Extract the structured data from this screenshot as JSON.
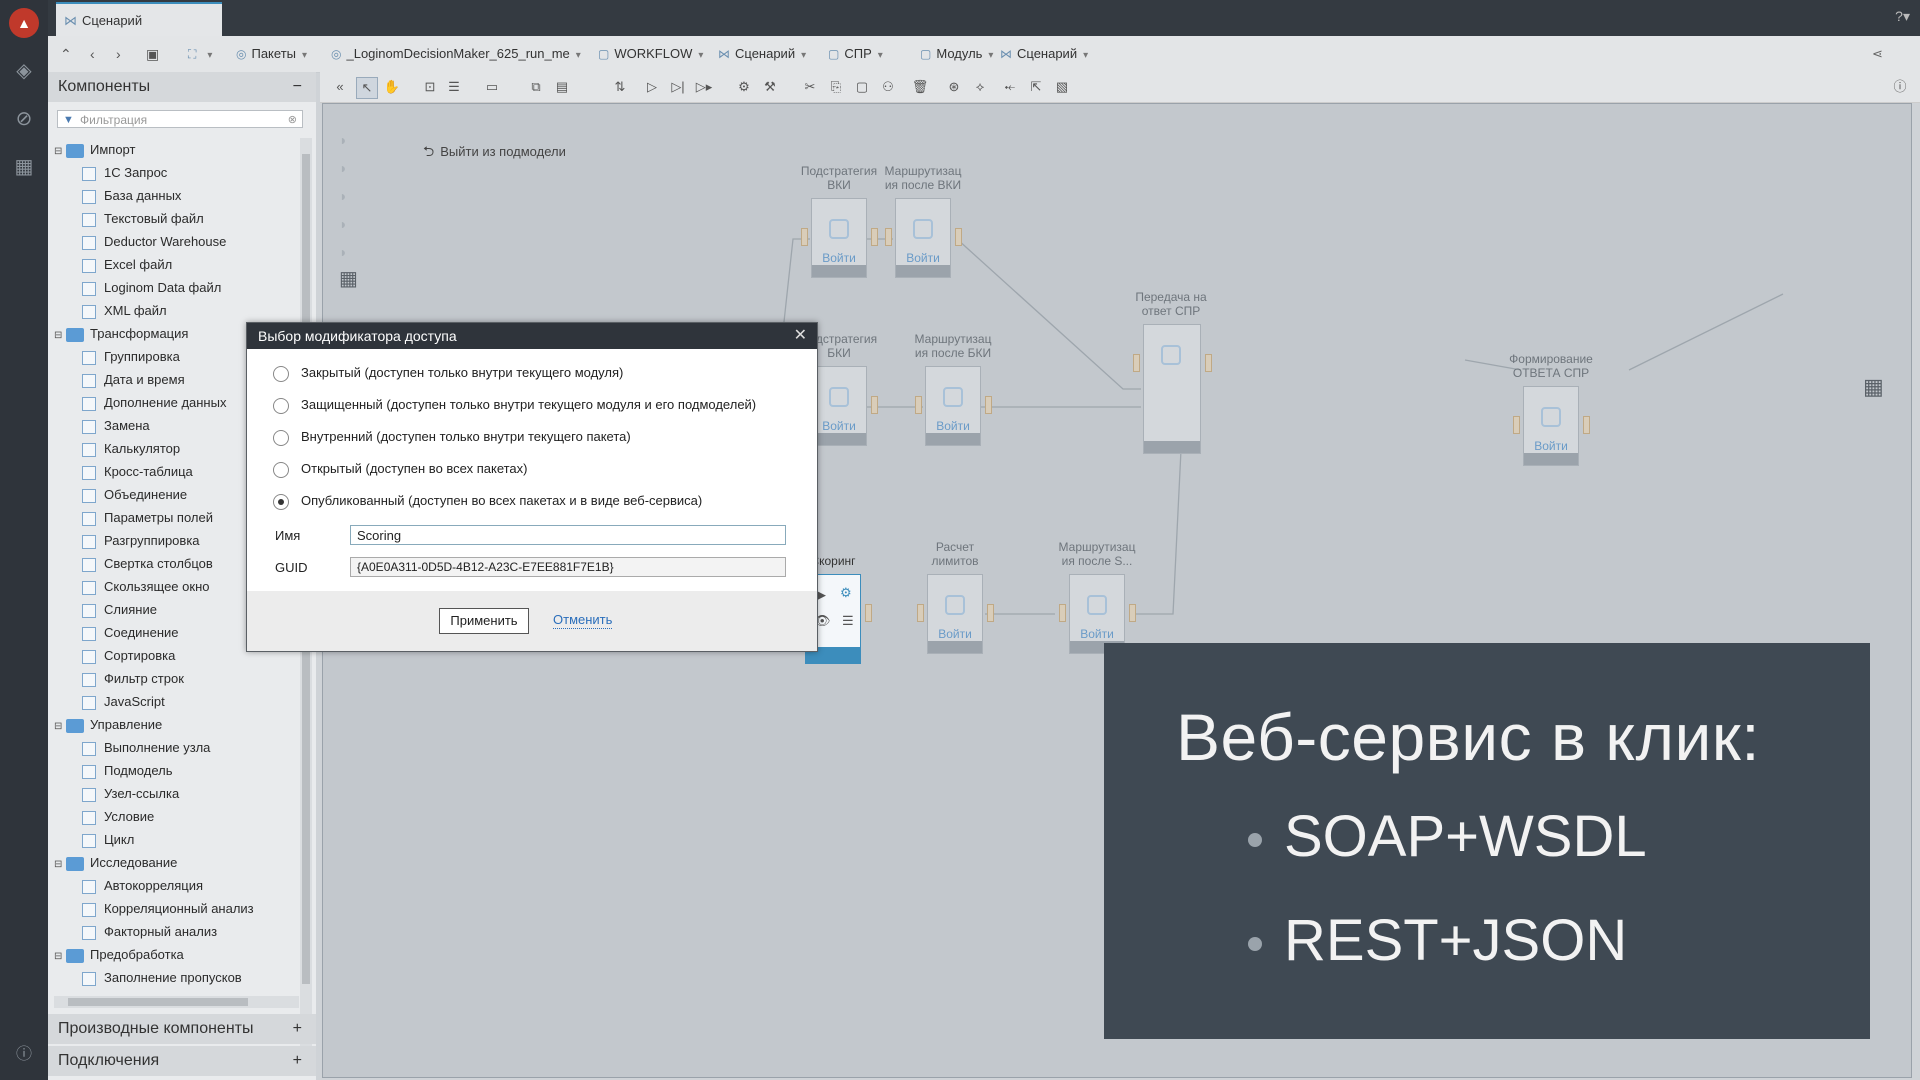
{
  "tabs": {
    "active": "Сценарий"
  },
  "breadcrumbs": [
    {
      "icon": "package-icon",
      "label": ""
    },
    {
      "icon": "package-icon",
      "label": "Пакеты"
    },
    {
      "icon": "package-icon",
      "label": "_LoginomDecisionMaker_625_run_me"
    },
    {
      "icon": "module-icon",
      "label": "WORKFLOW"
    },
    {
      "icon": "scenario-icon",
      "label": "Сценарий"
    },
    {
      "icon": "module-icon",
      "label": "СПР"
    },
    {
      "icon": "module-icon",
      "label": "Модуль"
    },
    {
      "icon": "scenario-icon",
      "label": "Сценарий"
    }
  ],
  "left_panel": {
    "title": "Компоненты",
    "filter_placeholder": "Фильтрация",
    "tree": [
      {
        "type": "folder",
        "label": "Импорт"
      },
      {
        "type": "leaf",
        "label": "1С Запрос"
      },
      {
        "type": "leaf",
        "label": "База данных"
      },
      {
        "type": "leaf",
        "label": "Текстовый файл"
      },
      {
        "type": "leaf",
        "label": "Deductor Warehouse"
      },
      {
        "type": "leaf",
        "label": "Excel файл"
      },
      {
        "type": "leaf",
        "label": "Loginom Data файл"
      },
      {
        "type": "leaf",
        "label": "XML файл"
      },
      {
        "type": "folder",
        "label": "Трансформация"
      },
      {
        "type": "leaf",
        "label": "Группировка"
      },
      {
        "type": "leaf",
        "label": "Дата и время"
      },
      {
        "type": "leaf",
        "label": "Дополнение данных"
      },
      {
        "type": "leaf",
        "label": "Замена"
      },
      {
        "type": "leaf",
        "label": "Калькулятор"
      },
      {
        "type": "leaf",
        "label": "Кросс-таблица"
      },
      {
        "type": "leaf",
        "label": "Объединение"
      },
      {
        "type": "leaf",
        "label": "Параметры полей"
      },
      {
        "type": "leaf",
        "label": "Разгруппировка"
      },
      {
        "type": "leaf",
        "label": "Свертка столбцов"
      },
      {
        "type": "leaf",
        "label": "Скользящее окно"
      },
      {
        "type": "leaf",
        "label": "Слияние"
      },
      {
        "type": "leaf",
        "label": "Соединение"
      },
      {
        "type": "leaf",
        "label": "Сортировка"
      },
      {
        "type": "leaf",
        "label": "Фильтр строк"
      },
      {
        "type": "leaf",
        "label": "JavaScript"
      },
      {
        "type": "folder",
        "label": "Управление"
      },
      {
        "type": "leaf",
        "label": "Выполнение узла"
      },
      {
        "type": "leaf",
        "label": "Подмодель"
      },
      {
        "type": "leaf",
        "label": "Узел-ссылка"
      },
      {
        "type": "leaf",
        "label": "Условие"
      },
      {
        "type": "leaf",
        "label": "Цикл"
      },
      {
        "type": "folder",
        "label": "Исследование"
      },
      {
        "type": "leaf",
        "label": "Автокорреляция"
      },
      {
        "type": "leaf",
        "label": "Корреляционный анализ"
      },
      {
        "type": "leaf",
        "label": "Факторный анализ"
      },
      {
        "type": "folder",
        "label": "Предобработка"
      },
      {
        "type": "leaf",
        "label": "Заполнение пропусков"
      }
    ],
    "derived_components": "Производные компоненты",
    "connections": "Подключения"
  },
  "canvas": {
    "exit_submodel": "Выйти из подмодели",
    "enter_label": "Войти",
    "nodes": [
      {
        "id": "podstr-vki",
        "title": "Подстратегия\nВКИ",
        "enter": true
      },
      {
        "id": "marsh-vki",
        "title": "Маршрутизац\nия после ВКИ",
        "enter": true
      },
      {
        "id": "podstr-bki",
        "title": "Подстратегия\nБКИ",
        "enter": true
      },
      {
        "id": "marsh-bki",
        "title": "Маршрутизац\nия после БКИ",
        "enter": true
      },
      {
        "id": "peredacha",
        "title": "Передача на\nответ СПР",
        "enter": false
      },
      {
        "id": "formir",
        "title": "Формирование\nОТВЕТА СПР",
        "enter": true
      },
      {
        "id": "skoring",
        "title": "Скоринг",
        "enter": false
      },
      {
        "id": "raschet",
        "title": "Расчет\nлимитов",
        "enter": true
      },
      {
        "id": "marsh-s",
        "title": "Маршрутизац\nия после S...",
        "enter": true
      }
    ]
  },
  "dialog": {
    "title": "Выбор модификатора доступа",
    "options": [
      {
        "label": "Закрытый (доступен только внутри текущего модуля)",
        "selected": false
      },
      {
        "label": "Защищенный (доступен только внутри текущего модуля и его подмоделей)",
        "selected": false
      },
      {
        "label": "Внутренний (доступен только внутри текущего пакета)",
        "selected": false
      },
      {
        "label": "Открытый (доступен во всех пакетах)",
        "selected": false
      },
      {
        "label": "Опубликованный (доступен во всех пакетах и в виде веб-сервиса)",
        "selected": true
      }
    ],
    "name_label": "Имя",
    "name_value": "Scoring",
    "guid_label": "GUID",
    "guid_value": "{A0E0A311-0D5D-4B12-A23C-E7EE881F7E1B}",
    "apply": "Применить",
    "cancel": "Отменить"
  },
  "slide": {
    "title": "Веб-сервис в клик:",
    "bullets": [
      "SOAP+WSDL",
      "REST+JSON"
    ]
  },
  "colors": {
    "rail": "#2f343b",
    "accent": "#3c8dbc",
    "slide_bg": "#3f4953"
  }
}
